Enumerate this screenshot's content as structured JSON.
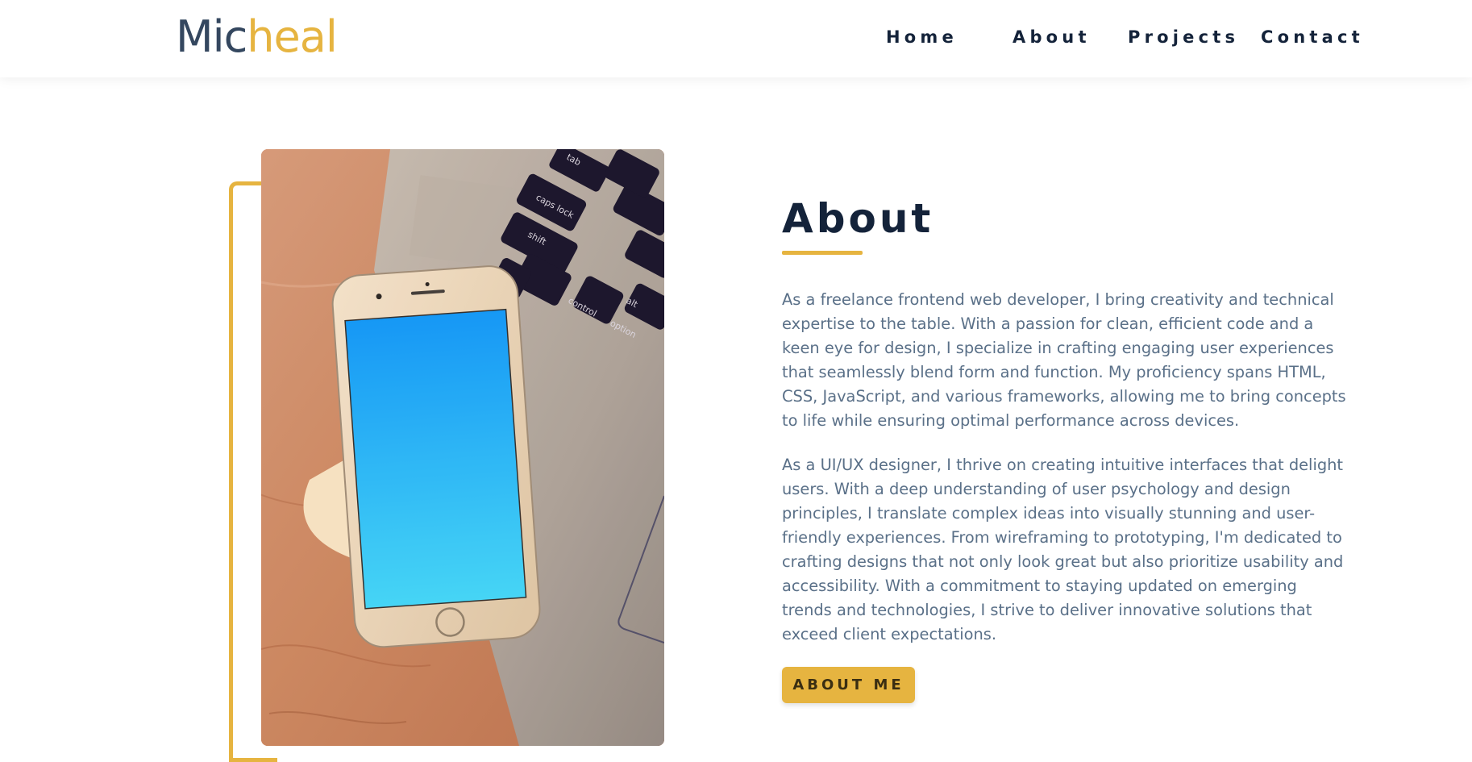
{
  "header": {
    "logo_part1": "Mic",
    "logo_part2": "heal",
    "nav": [
      {
        "label": "Home"
      },
      {
        "label": "About"
      },
      {
        "label": "Projects"
      },
      {
        "label": "Contact"
      }
    ]
  },
  "about": {
    "title": "About",
    "paragraphs": [
      "As a freelance frontend web developer, I bring creativity and technical expertise to the table. With a passion for clean, efficient code and a keen eye for design, I specialize in crafting engaging user experiences that seamlessly blend form and function. My proficiency spans HTML, CSS, JavaScript, and various frameworks, allowing me to bring concepts to life while ensuring optimal performance across devices.",
      "As a UI/UX designer, I thrive on creating intuitive interfaces that delight users. With a deep understanding of user psychology and design principles, I translate complex ideas into visually stunning and user-friendly experiences. From wireframing to prototyping, I'm dedicated to crafting designs that not only look great but also prioritize usability and accessibility. With a commitment to staying updated on emerging trends and technologies, I strive to deliver innovative solutions that exceed client expectations."
    ],
    "button_label": "ABOUT ME"
  },
  "photo": {
    "keys": [
      "tab",
      "caps lock",
      "shift",
      "control",
      "alt",
      "option"
    ]
  },
  "colors": {
    "accent": "#e6b440",
    "navy": "#14233a",
    "logo_dark": "#34475f",
    "body_text": "#5a7088"
  }
}
